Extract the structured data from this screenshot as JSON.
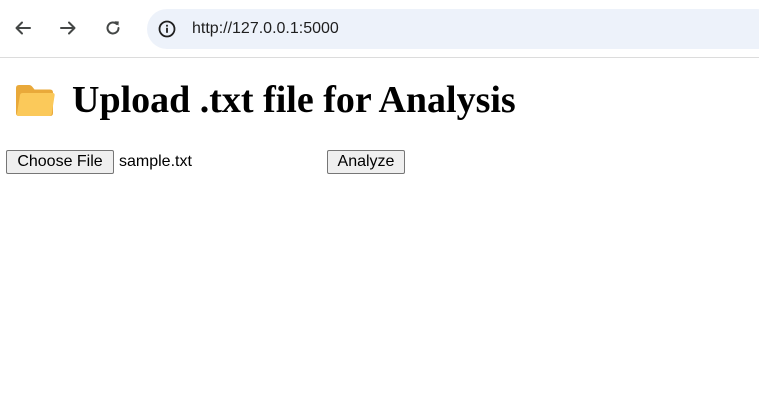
{
  "browser": {
    "url": "http://127.0.0.1:5000",
    "back_icon": "back-arrow-icon",
    "forward_icon": "forward-arrow-icon",
    "reload_icon": "reload-icon",
    "site_info_icon": "info-icon"
  },
  "page": {
    "heading": {
      "icon": "folder-icon",
      "text": "Upload .txt file for Analysis"
    },
    "file_input": {
      "button_label": "Choose File",
      "selected_file": "sample.txt"
    },
    "analyze_button": {
      "label": "Analyze"
    }
  },
  "colors": {
    "omnibox_bg": "#edf2fa",
    "folder_icon": "#f8c14a"
  }
}
